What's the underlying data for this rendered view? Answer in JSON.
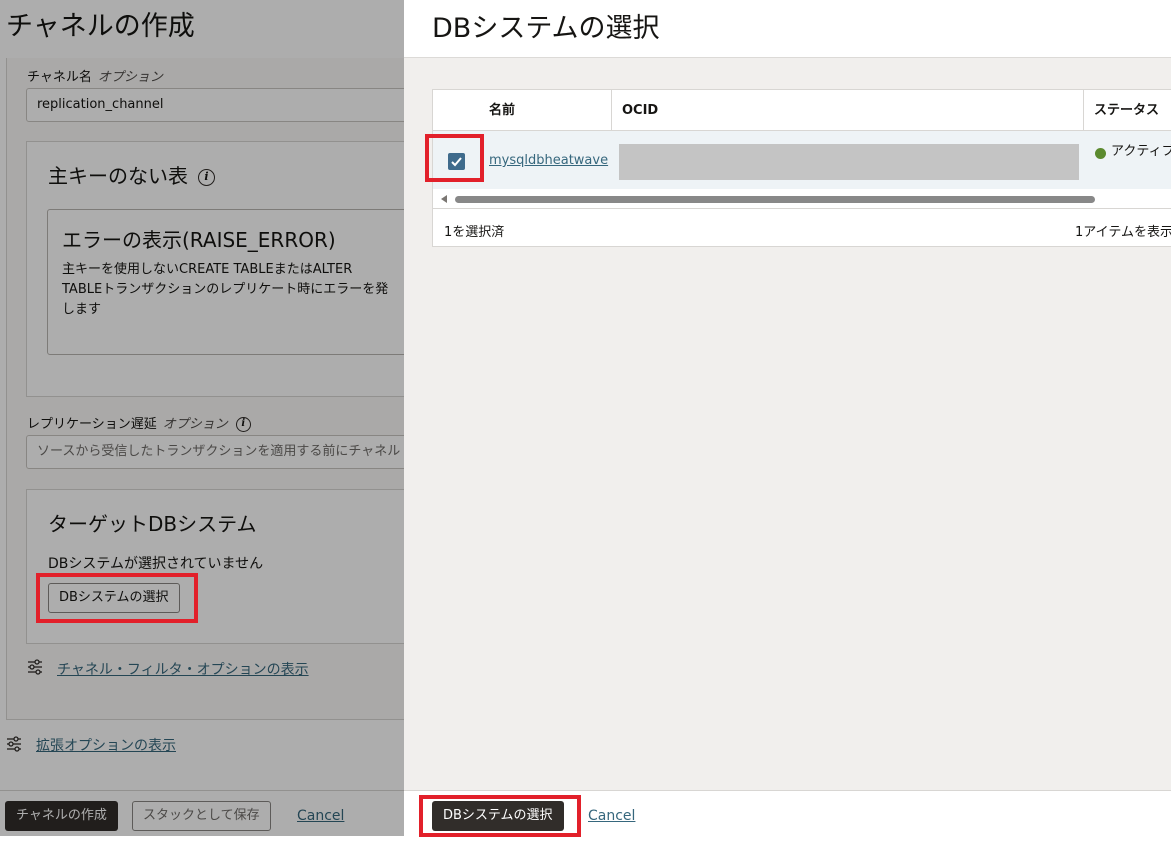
{
  "background_form": {
    "page_title": "チャネルの作成",
    "channel_name": {
      "label": "チャネル名",
      "optional": "オプション",
      "value": "replication_channel"
    },
    "no_pk_section": {
      "title": "主キーのない表",
      "card_title": "エラーの表示(RAISE_ERROR)",
      "card_desc": "主キーを使用しないCREATE TABLEまたはALTER TABLEトランザクションのレプリケート時にエラーを発します"
    },
    "replication_delay": {
      "label": "レプリケーション遅延",
      "optional": "オプション",
      "placeholder": "ソースから受信したトランザクションを適用する前にチャネル"
    },
    "target_section": {
      "title": "ターゲットDBシステム",
      "no_selection": "DBシステムが選択されていません",
      "select_button": "DBシステムの選択"
    },
    "channel_filter_link": "チャネル・フィルタ・オプションの表示",
    "advanced_link": "拡張オプションの表示",
    "footer": {
      "create": "チャネルの作成",
      "save_stack": "スタックとして保存",
      "cancel": "Cancel"
    }
  },
  "dialog": {
    "title": "DBシステムの選択",
    "table": {
      "columns": [
        "名前",
        "OCID",
        "ステータス"
      ],
      "rows": [
        {
          "checked": true,
          "name": "mysqldbheatwave",
          "ocid": "",
          "status": "アクティブ"
        }
      ],
      "selected_count": "1を選択済",
      "items_shown": "1アイテムを表示"
    },
    "footer": {
      "select": "DBシステムの選択",
      "cancel": "Cancel"
    }
  },
  "colors": {
    "primary_button": "#312d2a",
    "link": "#36677d",
    "highlight": "#e2202a",
    "status_active": "#5b8a2e",
    "checkbox": "#3f6b8c"
  }
}
